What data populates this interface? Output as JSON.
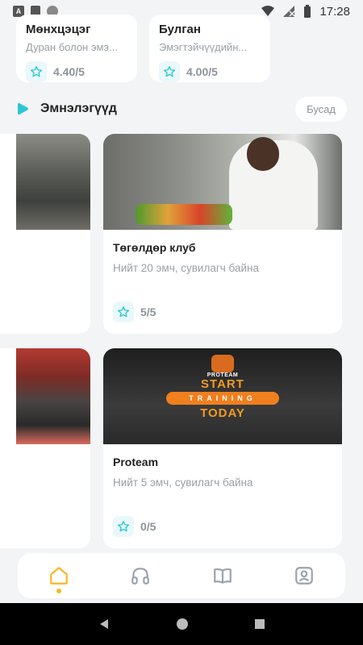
{
  "status_bar": {
    "time": "17:28"
  },
  "top_cards": [
    {
      "title": "Мөнхцэцэг",
      "subtitle": "Дуран болон эмэ...",
      "rating": "4.40/5"
    },
    {
      "title": "Булган",
      "subtitle": "Эмэгтэйчүүдийн...",
      "rating": "4.00/5"
    }
  ],
  "section": {
    "title": "Эмнэлэгүүд",
    "more_label": "Бусад"
  },
  "hospitals": [
    {
      "name": "Төгөлдөр клуб",
      "desc": "Нийт 20 эмч, сувилагч байна",
      "rating": "5/5"
    },
    {
      "name": "Proteam",
      "desc": "Нийт 5 эмч, сувилагч байна",
      "rating": "0/5"
    }
  ],
  "proteam_image": {
    "brand": "PROTEAM",
    "line1": "START",
    "line2": "TRAINING",
    "line3": "TODAY"
  },
  "nav": {
    "active": "home",
    "items": [
      "home-icon",
      "headphones-icon",
      "book-icon",
      "profile-icon"
    ]
  },
  "colors": {
    "accent": "#f5b921",
    "icon": "#9aa3ad",
    "teal": "#2bc6d6"
  }
}
